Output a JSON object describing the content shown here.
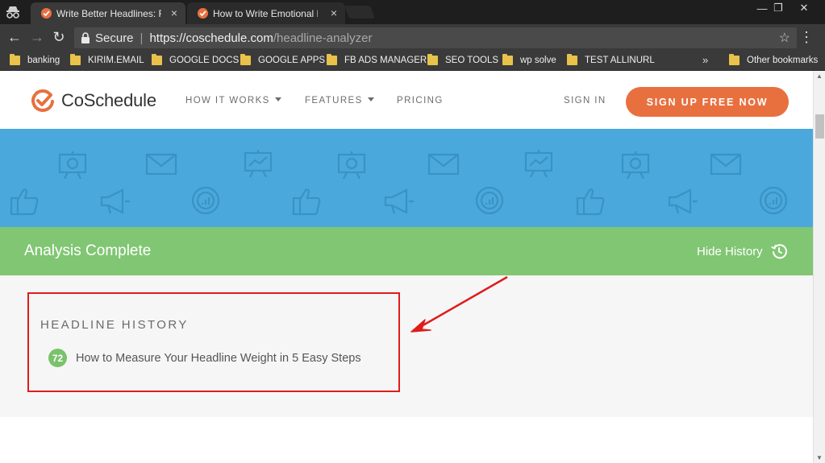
{
  "browser": {
    "tabs": [
      {
        "title": "Write Better Headlines: Fre",
        "active": true
      },
      {
        "title": "How to Write Emotional He",
        "active": false
      }
    ],
    "tab_close": "×",
    "window_controls": {
      "minimize": "—",
      "restore": "❐",
      "close": "✕"
    },
    "nav": {
      "back": "←",
      "forward": "→",
      "reload": "↻"
    },
    "address": {
      "security_label": "Secure",
      "separator": "|",
      "host": "https://coschedule.com",
      "path": "/headline-analyzer"
    },
    "star": "☆",
    "menu": "⋮",
    "bookmarks": [
      "banking",
      "KIRIM.EMAIL",
      "GOOGLE DOCS",
      "GOOGLE APPS",
      "FB ADS MANAGER",
      "SEO TOOLS",
      "wp solve",
      "TEST ALLINURL"
    ],
    "bookmarks_overflow": "»",
    "other_bookmarks": "Other bookmarks"
  },
  "site": {
    "logo_text": "CoSchedule",
    "nav": {
      "how_it_works": "HOW IT WORKS",
      "features": "FEATURES",
      "pricing": "PRICING",
      "sign_in": "SIGN IN"
    },
    "signup_label": "SIGN UP FREE NOW",
    "brand_colors": {
      "orange": "#e8703f",
      "blue": "#4aa8dc",
      "green": "#80c673"
    }
  },
  "analysis": {
    "status": "Analysis Complete",
    "hide_history": "Hide History"
  },
  "history": {
    "heading": "HEADLINE HISTORY",
    "items": [
      {
        "score": "72",
        "headline": "How to Measure Your Headline Weight in 5 Easy Steps"
      }
    ]
  },
  "annotation": {
    "box_color": "#e01c1c"
  }
}
